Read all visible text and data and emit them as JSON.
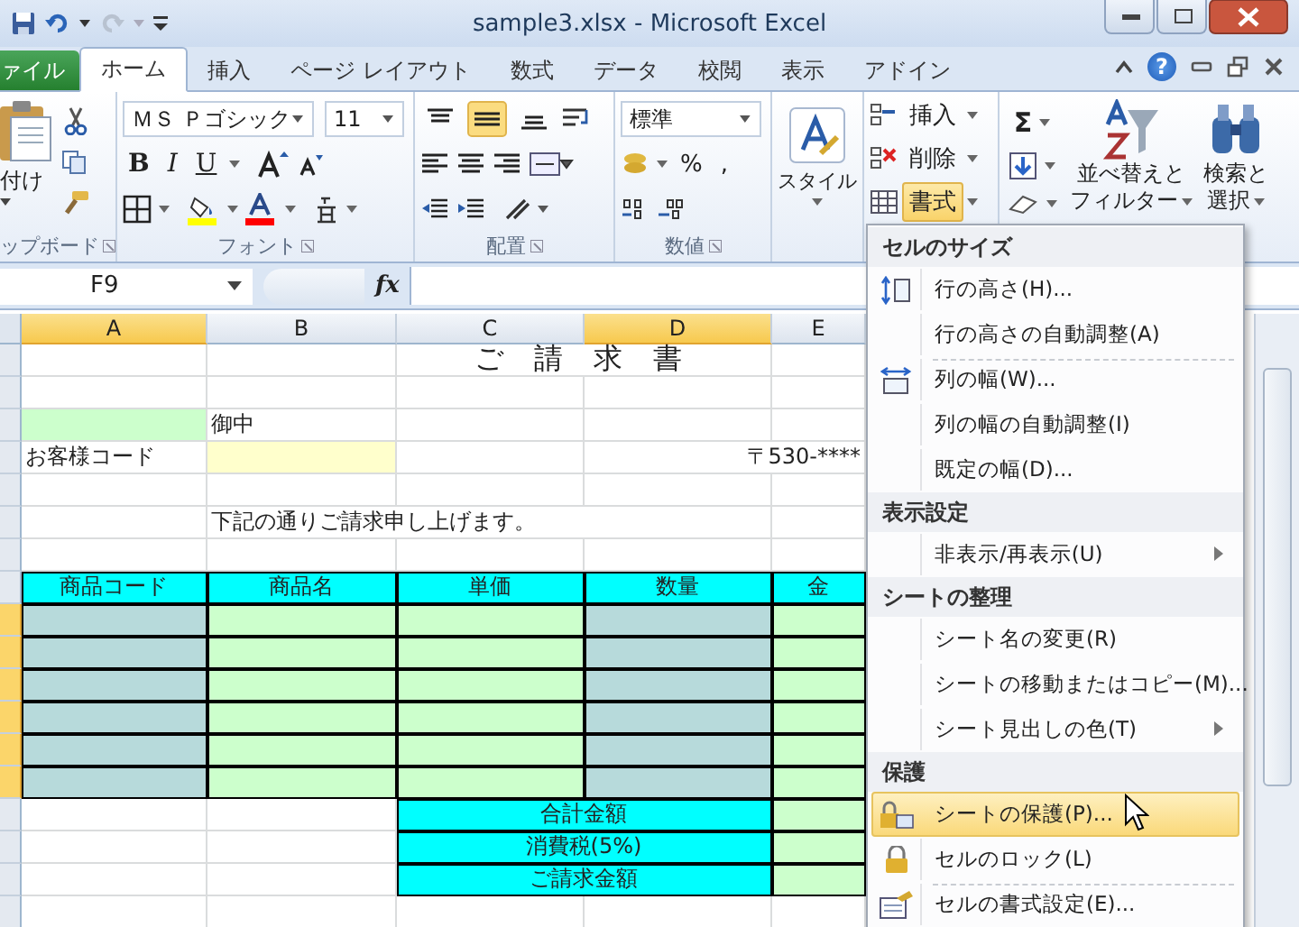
{
  "window": {
    "title": "sample3.xlsx - Microsoft Excel"
  },
  "ribbon_tabs": [
    {
      "label": "ァイル",
      "kind": "file",
      "selected": false
    },
    {
      "label": "ホーム",
      "kind": "tab",
      "selected": true
    },
    {
      "label": "挿入",
      "kind": "tab",
      "selected": false
    },
    {
      "label": "ページ レイアウト",
      "kind": "tab",
      "selected": false
    },
    {
      "label": "数式",
      "kind": "tab",
      "selected": false
    },
    {
      "label": "データ",
      "kind": "tab",
      "selected": false
    },
    {
      "label": "校閲",
      "kind": "tab",
      "selected": false
    },
    {
      "label": "表示",
      "kind": "tab",
      "selected": false
    },
    {
      "label": "アドイン",
      "kind": "tab",
      "selected": false
    }
  ],
  "help_glyph": "?",
  "ribbon": {
    "clipboard": {
      "paste_label": "付け",
      "group_label": "ップボード"
    },
    "font": {
      "name": "ＭＳ Ｐゴシック",
      "size": "11",
      "bold": "B",
      "italic": "I",
      "underline": "U",
      "group_label": "フォント"
    },
    "alignment": {
      "top_row": [
        {
          "selected": false
        },
        {
          "selected": true
        },
        {
          "selected": false
        }
      ],
      "group_label": "配置"
    },
    "number": {
      "format": "標準",
      "percent": "%",
      "comma": ",",
      "group_label": "数値"
    },
    "styles": {
      "label": "スタイル"
    },
    "cells": [
      {
        "label": "挿入",
        "selected": false
      },
      {
        "label": "削除",
        "selected": false
      },
      {
        "label": "書式",
        "selected": true
      }
    ],
    "editing": {
      "sum": "Σ",
      "sort_lines": [
        "並べ替えと",
        "フィルター"
      ],
      "find_lines": [
        "検索と",
        "選択"
      ]
    }
  },
  "formula_bar": {
    "name_box": "F9",
    "function_label": "fx"
  },
  "columns": [
    {
      "label": "A",
      "selected": true
    },
    {
      "label": "B",
      "selected": false
    },
    {
      "label": "C",
      "selected": false
    },
    {
      "label": "D",
      "selected": true
    },
    {
      "label": "E",
      "selected": false
    }
  ],
  "rows": [
    {
      "kind": "title",
      "selected": false,
      "text": "ご 請 求 書"
    },
    {
      "kind": "blank",
      "selected": false
    },
    {
      "kind": "addressee",
      "selected": false,
      "text": "御中"
    },
    {
      "kind": "customer",
      "selected": false,
      "label": "お客様コード",
      "postal": "〒530-****"
    },
    {
      "kind": "blank",
      "selected": false
    },
    {
      "kind": "note",
      "selected": false,
      "text": "下記の通りご請求申し上げます。"
    },
    {
      "kind": "blank",
      "selected": false
    },
    {
      "kind": "header",
      "selected": false,
      "cells": [
        "商品コード",
        "商品名",
        "単価",
        "数量",
        "金"
      ]
    },
    {
      "kind": "item",
      "selected": true
    },
    {
      "kind": "item",
      "selected": true
    },
    {
      "kind": "item",
      "selected": true
    },
    {
      "kind": "item",
      "selected": true
    },
    {
      "kind": "item",
      "selected": true
    },
    {
      "kind": "item",
      "selected": true
    },
    {
      "kind": "total",
      "selected": false,
      "label": "合計金額"
    },
    {
      "kind": "total",
      "selected": false,
      "label": "消費税(5%)"
    },
    {
      "kind": "total",
      "selected": false,
      "label": "ご請求金額"
    },
    {
      "kind": "blank",
      "selected": false
    }
  ],
  "format_menu": {
    "sections": [
      {
        "title": "セルのサイズ",
        "items": [
          {
            "label": "行の高さ(H)...",
            "selected": false,
            "submenu": false,
            "divider_before": false
          },
          {
            "label": "行の高さの自動調整(A)",
            "selected": false,
            "submenu": false,
            "divider_before": false
          },
          {
            "label": "列の幅(W)...",
            "selected": false,
            "submenu": false,
            "divider_before": true
          },
          {
            "label": "列の幅の自動調整(I)",
            "selected": false,
            "submenu": false,
            "divider_before": false
          },
          {
            "label": "既定の幅(D)...",
            "selected": false,
            "submenu": false,
            "divider_before": false
          }
        ]
      },
      {
        "title": "表示設定",
        "items": [
          {
            "label": "非表示/再表示(U)",
            "selected": false,
            "submenu": true,
            "divider_before": false
          }
        ]
      },
      {
        "title": "シートの整理",
        "items": [
          {
            "label": "シート名の変更(R)",
            "selected": false,
            "submenu": false,
            "divider_before": false
          },
          {
            "label": "シートの移動またはコピー(M)...",
            "selected": false,
            "submenu": false,
            "divider_before": false
          },
          {
            "label": "シート見出しの色(T)",
            "selected": false,
            "submenu": true,
            "divider_before": false
          }
        ]
      },
      {
        "title": "保護",
        "items": [
          {
            "label": "シートの保護(P)...",
            "selected": true,
            "submenu": false,
            "divider_before": false
          },
          {
            "label": "セルのロック(L)",
            "selected": false,
            "submenu": false,
            "divider_before": false
          },
          {
            "label": "セルの書式設定(E)...",
            "selected": false,
            "submenu": false,
            "divider_before": true
          }
        ]
      }
    ]
  }
}
